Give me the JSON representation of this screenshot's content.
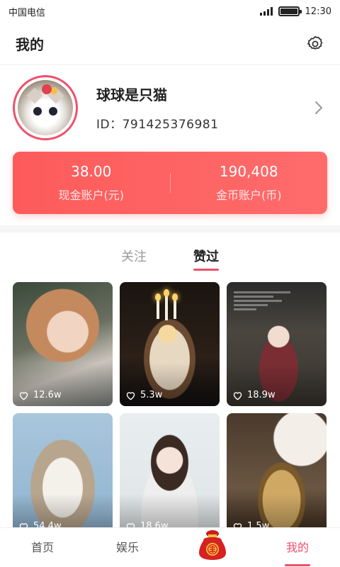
{
  "status_bar": {
    "carrier": "中国电信",
    "time": "12:30"
  },
  "header": {
    "title": "我的"
  },
  "profile": {
    "name": "球球是只猫",
    "id_text": "ID：791425376981"
  },
  "accounts": [
    {
      "value": "38.00",
      "label": "现金账户(元)"
    },
    {
      "value": "190,408",
      "label": "金币账户(币)"
    }
  ],
  "tabs": [
    {
      "label": "关注",
      "active": false
    },
    {
      "label": "赞过",
      "active": true
    }
  ],
  "cards": [
    {
      "likes": "12.6w"
    },
    {
      "likes": "5.3w"
    },
    {
      "likes": "18.9w"
    },
    {
      "likes": "54.4w"
    },
    {
      "likes": "18.6w"
    },
    {
      "likes": "1.5w"
    }
  ],
  "bottom_nav": [
    {
      "label": "首页",
      "active": false
    },
    {
      "label": "娱乐",
      "active": false
    },
    {
      "label": "我的",
      "active": true
    }
  ],
  "colors": {
    "accent": "#f0506a",
    "account_card": "#fd5b5b"
  }
}
